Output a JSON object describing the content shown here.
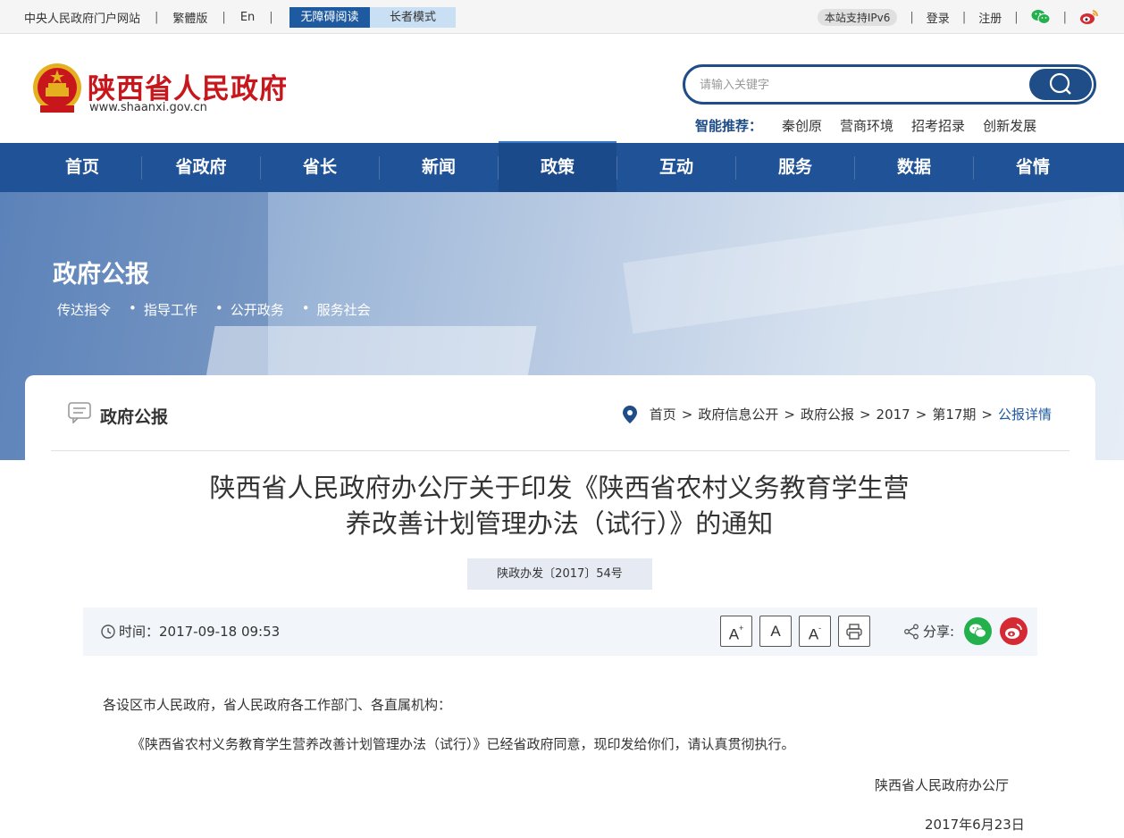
{
  "topbar": {
    "portal": "中央人民政府门户网站",
    "traditional": "繁體版",
    "english": "En",
    "accessible": "无障碍阅读",
    "elder": "长者模式",
    "ipv6": "本站支持IPv6",
    "login": "登录",
    "register": "注册",
    "sep": "|"
  },
  "header": {
    "title": "陕西省人民政府",
    "url": "www.shaanxi.gov.cn",
    "search_placeholder": "请输入关键字",
    "rec_label": "智能推荐：",
    "rec_items": [
      "秦创原",
      "营商环境",
      "招考招录",
      "创新发展"
    ]
  },
  "nav": {
    "items": [
      "首页",
      "省政府",
      "省长",
      "新闻",
      "政策",
      "互动",
      "服务",
      "数据",
      "省情"
    ],
    "active": "政策"
  },
  "banner": {
    "title": "政府公报",
    "links": [
      "传达指令",
      "指导工作",
      "公开政务",
      "服务社会"
    ],
    "dot": "•"
  },
  "card": {
    "title": "政府公报",
    "breadcrumb": [
      "首页",
      "政府信息公开",
      "政府公报",
      "2017",
      "第17期",
      "公报详情"
    ],
    "arrow": ">"
  },
  "doc": {
    "title_line1": "陕西省人民政府办公厅关于印发《陕西省农村义务教育学生营",
    "title_line2": "养改善计划管理办法（试行）》的通知",
    "number": "陕政办发〔2017〕54号",
    "time": "时间：2017-09-18 09:53",
    "font_large": "A",
    "font_mid": "A",
    "font_small": "A",
    "share": "分享:",
    "p1": "各设区市人民政府，省人民政府各工作部门、各直属机构：",
    "p2": "《陕西省农村义务教育学生营养改善计划管理办法（试行）》已经省政府同意，现印发给你们，请认真贯彻执行。",
    "signature": "陕西省人民政府办公厅",
    "date": "2017年6月23日"
  },
  "colors": {
    "brand_blue": "#1f5296",
    "brand_red": "#c8161d",
    "wechat_green": "#22b14c",
    "weibo_red": "#d52a34"
  }
}
